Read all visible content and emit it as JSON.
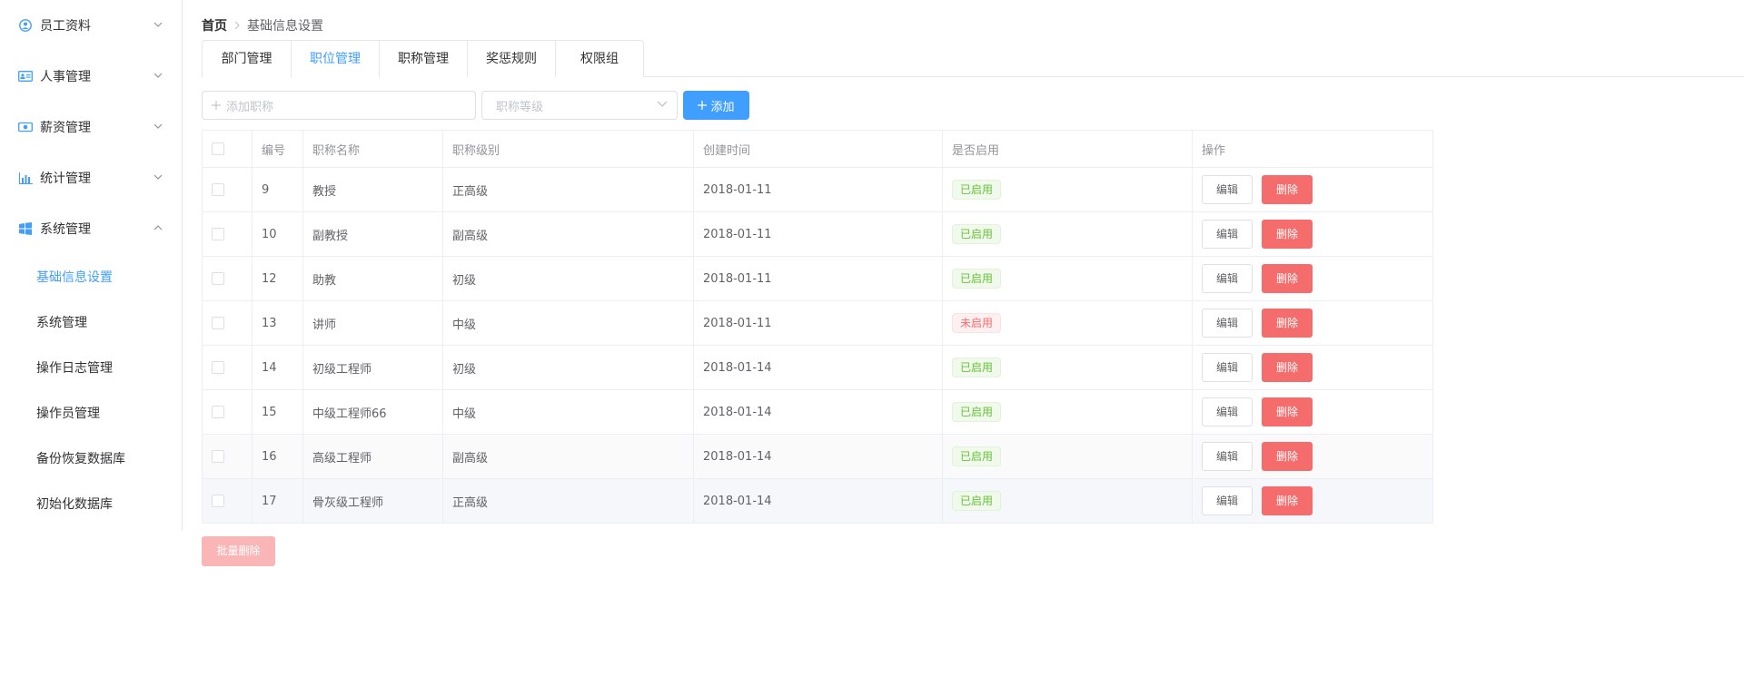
{
  "sidebar": {
    "menus": [
      {
        "label": "员工资料",
        "icon": "user-circle-icon",
        "arrow": "chevron-down-icon"
      },
      {
        "label": "人事管理",
        "icon": "id-card-icon",
        "arrow": "chevron-down-icon"
      },
      {
        "label": "薪资管理",
        "icon": "money-icon",
        "arrow": "chevron-down-icon"
      },
      {
        "label": "统计管理",
        "icon": "bar-chart-icon",
        "arrow": "chevron-down-icon"
      },
      {
        "label": "系统管理",
        "icon": "windows-icon",
        "arrow": "chevron-up-icon"
      }
    ],
    "submenu": [
      {
        "label": "基础信息设置",
        "active": true
      },
      {
        "label": "系统管理"
      },
      {
        "label": "操作日志管理"
      },
      {
        "label": "操作员管理"
      },
      {
        "label": "备份恢复数据库"
      },
      {
        "label": "初始化数据库"
      }
    ]
  },
  "breadcrumb": {
    "home": "首页",
    "current": "基础信息设置"
  },
  "tabs": [
    "部门管理",
    "职位管理",
    "职称管理",
    "奖惩规则",
    "权限组"
  ],
  "active_tab": 1,
  "toolbar": {
    "input_placeholder": "添加职称",
    "select_placeholder": "职称等级",
    "add_label": "添加"
  },
  "table": {
    "columns": [
      "编号",
      "职称名称",
      "职称级别",
      "创建时间",
      "是否启用",
      "操作"
    ],
    "rows": [
      {
        "id": "9",
        "name": "教授",
        "level": "正高级",
        "created": "2018-01-11",
        "status": "已启用",
        "enabled": true
      },
      {
        "id": "10",
        "name": "副教授",
        "level": "副高级",
        "created": "2018-01-11",
        "status": "已启用",
        "enabled": true
      },
      {
        "id": "12",
        "name": "助教",
        "level": "初级",
        "created": "2018-01-11",
        "status": "已启用",
        "enabled": true
      },
      {
        "id": "13",
        "name": "讲师",
        "level": "中级",
        "created": "2018-01-11",
        "status": "未启用",
        "enabled": false
      },
      {
        "id": "14",
        "name": "初级工程师",
        "level": "初级",
        "created": "2018-01-14",
        "status": "已启用",
        "enabled": true
      },
      {
        "id": "15",
        "name": "中级工程师66",
        "level": "中级",
        "created": "2018-01-14",
        "status": "已启用",
        "enabled": true
      },
      {
        "id": "16",
        "name": "高级工程师",
        "level": "副高级",
        "created": "2018-01-14",
        "status": "已启用",
        "enabled": true
      },
      {
        "id": "17",
        "name": "骨灰级工程师",
        "level": "正高级",
        "created": "2018-01-14",
        "status": "已启用",
        "enabled": true
      }
    ],
    "edit_label": "编辑",
    "delete_label": "删除"
  },
  "batch_delete_label": "批量删除",
  "colors": {
    "primary": "#409EFF",
    "danger": "#F56C6C",
    "success": "#67C23A"
  }
}
